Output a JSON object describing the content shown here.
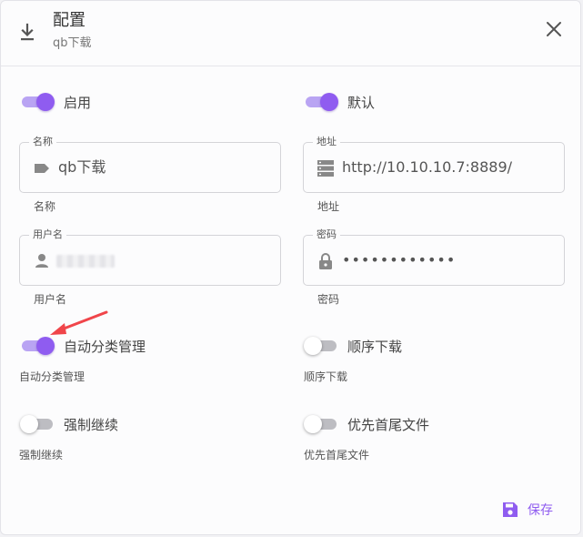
{
  "dialog": {
    "title": "配置",
    "subtitle": "qb下载",
    "icons": {
      "header": "download-icon",
      "close": "close-icon"
    }
  },
  "toggles": {
    "enable": {
      "label": "启用",
      "on": true
    },
    "default": {
      "label": "默认",
      "on": true
    },
    "auto_category": {
      "label": "自动分类管理",
      "on": true,
      "hint": "自动分类管理"
    },
    "sequential": {
      "label": "顺序下载",
      "on": false,
      "hint": "顺序下载"
    },
    "force_resume": {
      "label": "强制继续",
      "on": false,
      "hint": "强制继续"
    },
    "first_last": {
      "label": "优先首尾文件",
      "on": false,
      "hint": "优先首尾文件"
    }
  },
  "fields": {
    "name": {
      "legend": "名称",
      "value": "qb下载",
      "hint": "名称",
      "icon": "label-icon"
    },
    "address": {
      "legend": "地址",
      "value": "http://10.10.10.7:8889/",
      "hint": "地址",
      "icon": "server-icon"
    },
    "username": {
      "legend": "用户名",
      "value": "",
      "hint": "用户名",
      "icon": "person-icon"
    },
    "password": {
      "legend": "密码",
      "value": "••••••••••••",
      "hint": "密码",
      "icon": "lock-icon"
    }
  },
  "actions": {
    "save_label": "保存",
    "save_icon": "save-icon"
  },
  "colors": {
    "accent": "#8f5cf0",
    "accent_track": "#b9a4f3",
    "annotation_arrow": "#f0454a"
  }
}
